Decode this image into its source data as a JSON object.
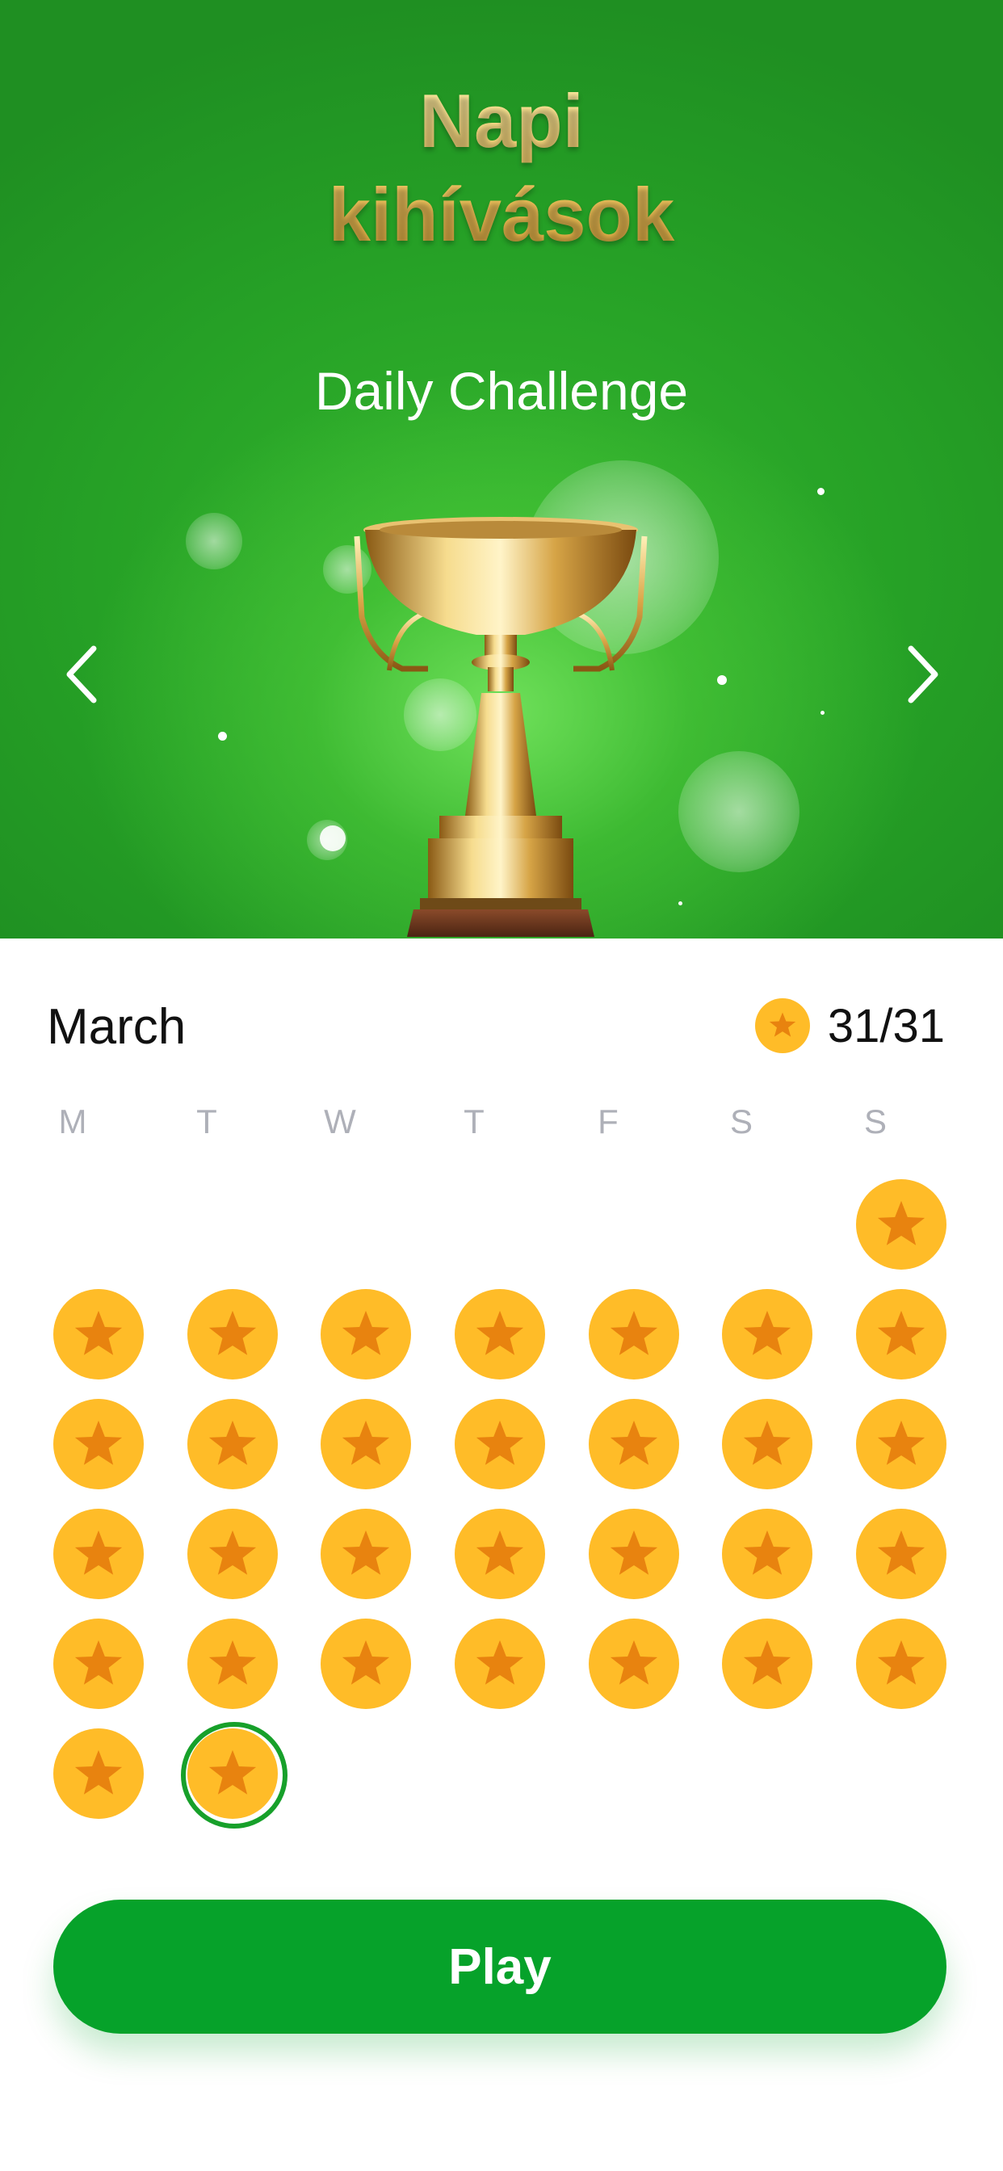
{
  "hero": {
    "title_line1": "Napi",
    "title_line2": "kihívások",
    "subtitle": "Daily Challenge",
    "prev_icon": "chevron-left-icon",
    "next_icon": "chevron-right-icon",
    "image": "trophy-icon"
  },
  "calendar": {
    "month": "March",
    "score_icon": "star-coin-icon",
    "score": "31/31",
    "weekdays": [
      "M",
      "T",
      "W",
      "T",
      "F",
      "S",
      "S"
    ],
    "days_completed": 31,
    "today": 31,
    "day_icon": "star-coin-icon"
  },
  "actions": {
    "play_label": "Play"
  },
  "colors": {
    "hero_green": "#26a126",
    "title_gold": "#f0c864",
    "coin_yellow": "#ffbc28",
    "coin_star": "#e8830f",
    "today_ring": "#17a02a",
    "play_button": "#06a22a",
    "weekday_gray": "#aeb0b8"
  }
}
